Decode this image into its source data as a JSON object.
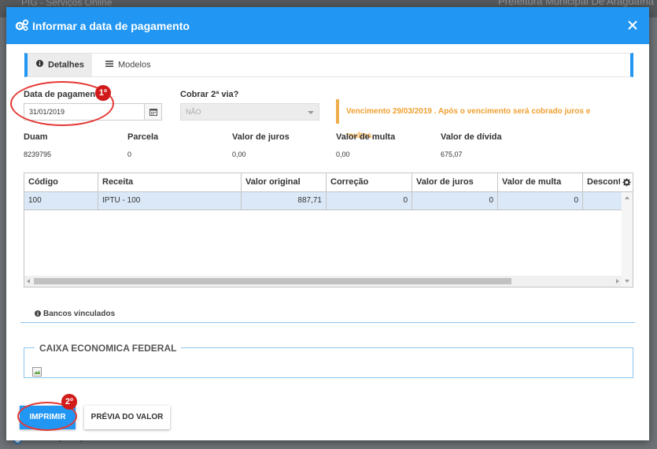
{
  "background": {
    "title": "PIG - Serviços Online",
    "right_text": "Prefeitura Municipal De Araguaína",
    "bottom_text": "Débitos (DND)"
  },
  "modal": {
    "title": "Informar a data de pagamento",
    "header_color": "#2196f3",
    "tabs": [
      {
        "label": "Detalhes",
        "icon": "info-icon",
        "active": true
      },
      {
        "label": "Modelos",
        "icon": "list-icon",
        "active": false
      }
    ]
  },
  "form": {
    "date_label": "Data de pagamento",
    "date_value": "31/01/2019",
    "cobrar_label": "Cobrar 2ª via?",
    "cobrar_value": "NÃO",
    "alert_text": "Vencimento 29/03/2019 . Após o vencimento será cobrado juros e multas.",
    "alert_color": "#f0ad4e"
  },
  "summary": [
    {
      "label": "Duam",
      "value": "8239795"
    },
    {
      "label": "Parcela",
      "value": "0"
    },
    {
      "label": "Valor de juros",
      "value": "0,00"
    },
    {
      "label": "Valor de multa",
      "value": "0,00"
    },
    {
      "label": "Valor de dívida",
      "value": "675,07"
    }
  ],
  "grid": {
    "columns": [
      "Código",
      "Receita",
      "Valor original",
      "Correção",
      "Valor de juros",
      "Valor de multa",
      "Desconto"
    ],
    "rows": [
      [
        "100",
        "IPTU - 100",
        "887,71",
        "0",
        "0",
        "0",
        ""
      ]
    ],
    "horizontal_scroll_fraction": 0.8
  },
  "bancos": {
    "tab_label": "Bancos vinculados",
    "legend": "CAIXA ECONOMICA FEDERAL"
  },
  "buttons": {
    "print": "IMPRIMIR",
    "preview": "PRÉVIA DO VALOR"
  },
  "annotations": {
    "step1": "1º",
    "step2": "2º",
    "color": "#e53935"
  }
}
